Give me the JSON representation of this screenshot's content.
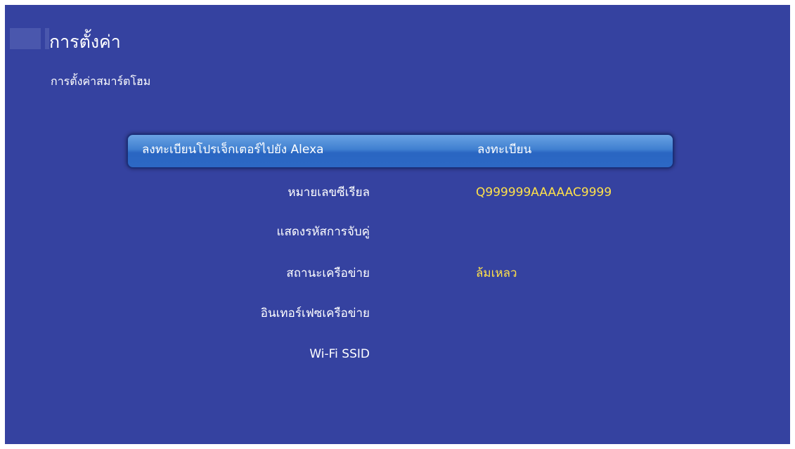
{
  "header": {
    "title": "การตั้งค่า",
    "subtitle": "การตั้งค่าสมาร์ตโฮม"
  },
  "menu": {
    "items": [
      {
        "label": "ลงทะเบียนโปรเจ็กเตอร์ไปยัง Alexa",
        "value": "ลงทะเบียน",
        "selected": true
      },
      {
        "label": "หมายเลขซีเรียล",
        "value": "Q999999AAAAAC9999"
      },
      {
        "label": "แสดงรหัสการจับคู่",
        "value": ""
      },
      {
        "label": "สถานะเครือข่าย",
        "value": "ล้มเหลว"
      },
      {
        "label": "อินเทอร์เฟซเครือข่าย",
        "value": ""
      },
      {
        "label": "Wi-Fi SSID",
        "value": ""
      }
    ]
  },
  "colors": {
    "background": "#3542a0",
    "highlight": "#3f7fd0",
    "value_text": "#ffe14a",
    "text": "#ffffff"
  }
}
